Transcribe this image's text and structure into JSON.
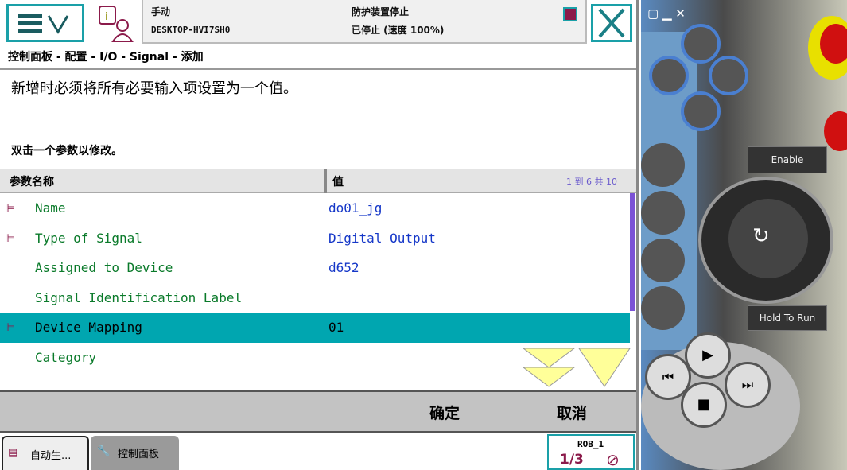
{
  "header": {
    "mode": "手动",
    "system": "DESKTOP-HVI7SH0",
    "safety": "防护装置停止",
    "state": "已停止 (速度 100%)"
  },
  "breadcrumb": "控制面板 - 配置 - I/O - Signal - 添加",
  "message": "新增时必须将所有必要输入项设置为一个值。",
  "hint": "双击一个参数以修改。",
  "table": {
    "col_name": "参数名称",
    "col_value": "值",
    "paging": "1 到 6 共 10",
    "rows": [
      {
        "name": "Name",
        "value": "do01_jg",
        "required": true
      },
      {
        "name": "Type of Signal",
        "value": "Digital Output",
        "required": true
      },
      {
        "name": "Assigned to Device",
        "value": "d652",
        "required": false
      },
      {
        "name": "Signal Identification Label",
        "value": "",
        "required": false
      },
      {
        "name": "Device Mapping",
        "value": "01",
        "required": true,
        "selected": true
      },
      {
        "name": "Category",
        "value": "",
        "required": false
      }
    ]
  },
  "buttons": {
    "ok": "确定",
    "cancel": "取消"
  },
  "taskbar": {
    "tab1": "自动生...",
    "tab2": "控制面板",
    "robot": "ROB_1",
    "fraction": "1/3"
  },
  "pendant": {
    "enable": "Enable",
    "hold": "Hold To Run"
  }
}
